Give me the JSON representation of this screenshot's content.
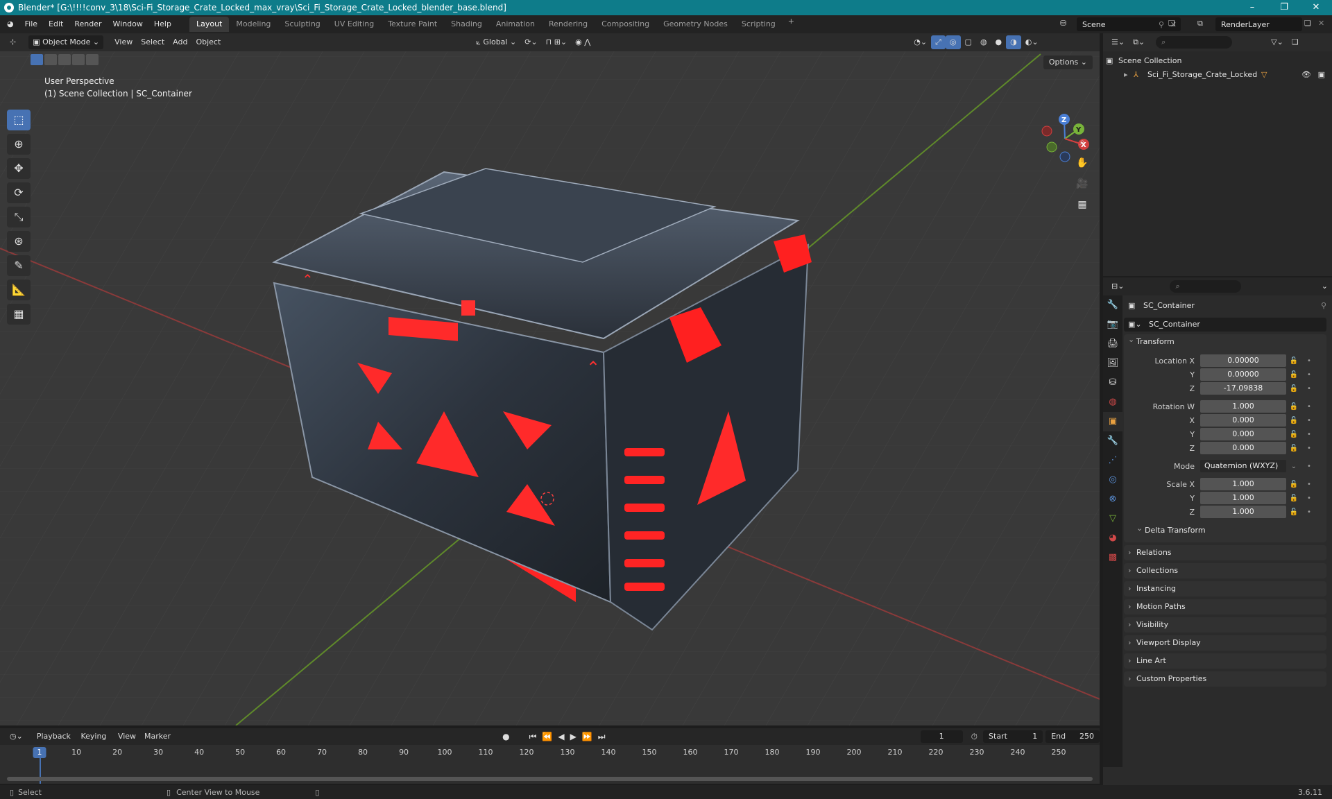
{
  "title_bar": {
    "title": "Blender* [G:\\!!!!conv_3\\18\\Sci-Fi_Storage_Crate_Locked_max_vray\\Sci_Fi_Storage_Crate_Locked_blender_base.blend]",
    "minimize": "–",
    "maximize": "❐",
    "close": "✕"
  },
  "menu": {
    "items": [
      "File",
      "Edit",
      "Render",
      "Window",
      "Help"
    ],
    "workspaces": [
      "Layout",
      "Modeling",
      "Sculpting",
      "UV Editing",
      "Texture Paint",
      "Shading",
      "Animation",
      "Rendering",
      "Compositing",
      "Geometry Nodes",
      "Scripting"
    ],
    "active_workspace": "Layout",
    "add_workspace": "+",
    "scene": "Scene",
    "render_layer": "RenderLayer"
  },
  "viewport": {
    "mode": "Object Mode",
    "menus": [
      "View",
      "Select",
      "Add",
      "Object"
    ],
    "orientation": "Global",
    "options": "Options",
    "perspective_label": "User Perspective",
    "collection_label": "(1) Scene Collection | SC_Container",
    "gizmo_axes": [
      "X",
      "Y",
      "Z"
    ]
  },
  "outliner": {
    "root": "Scene Collection",
    "object": "Sci_Fi_Storage_Crate_Locked"
  },
  "properties": {
    "object_name": "SC_Container",
    "data_name": "SC_Container",
    "transform": {
      "title": "Transform",
      "location_label": "Location X",
      "location": [
        "0.00000",
        "0.00000",
        "-17.09838"
      ],
      "rotation_label": "Rotation W",
      "rotation": [
        "1.000",
        "0.000",
        "0.000",
        "0.000"
      ],
      "mode_label": "Mode",
      "mode": "Quaternion (WXYZ)",
      "scale_label": "Scale X",
      "scale": [
        "1.000",
        "1.000",
        "1.000"
      ],
      "axis_y": "Y",
      "axis_z": "Z",
      "axis_x": "X",
      "delta": "Delta Transform"
    },
    "panels": [
      "Relations",
      "Collections",
      "Instancing",
      "Motion Paths",
      "Visibility",
      "Viewport Display",
      "Line Art",
      "Custom Properties"
    ]
  },
  "timeline": {
    "menus": [
      "Playback",
      "Keying",
      "View",
      "Marker"
    ],
    "current_frame": "1",
    "start_label": "Start",
    "start": "1",
    "end_label": "End",
    "end": "250",
    "ticks": [
      "1",
      "10",
      "20",
      "30",
      "40",
      "50",
      "60",
      "70",
      "80",
      "90",
      "100",
      "110",
      "120",
      "130",
      "140",
      "150",
      "160",
      "170",
      "180",
      "190",
      "200",
      "210",
      "220",
      "230",
      "240",
      "250"
    ]
  },
  "statusbar": {
    "select": "Select",
    "center_view": "Center View to Mouse",
    "version": "3.6.11"
  },
  "colors": {
    "accent": "#4772b3",
    "titlebar": "#0e7c8a",
    "crate_glow": "#ff2a2a"
  }
}
